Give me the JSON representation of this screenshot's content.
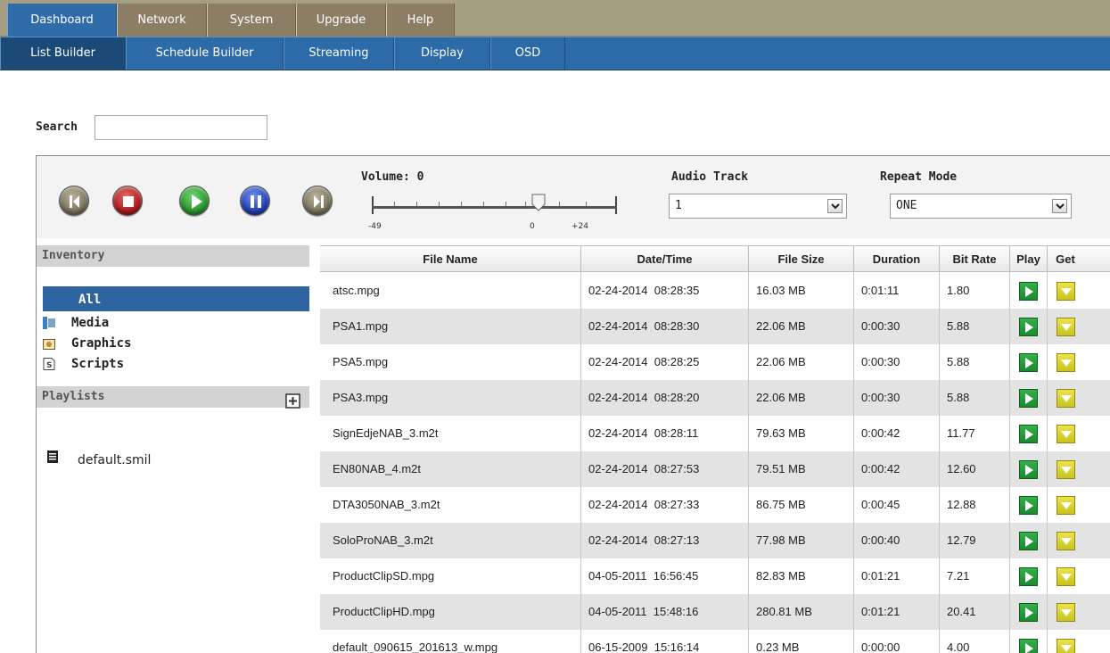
{
  "top_nav": {
    "tabs": [
      {
        "label": "Dashboard",
        "active": true
      },
      {
        "label": "Network"
      },
      {
        "label": "System"
      },
      {
        "label": "Upgrade"
      },
      {
        "label": "Help"
      }
    ]
  },
  "sub_nav": {
    "tabs": [
      {
        "label": "List Builder",
        "active": true
      },
      {
        "label": "Schedule Builder"
      },
      {
        "label": "Streaming"
      },
      {
        "label": "Display"
      },
      {
        "label": "OSD"
      }
    ]
  },
  "search": {
    "label": "Search",
    "value": ""
  },
  "controls": {
    "volume_label": "Volume: 0",
    "volume_value": 0,
    "volume_min_label": "-49",
    "volume_zero_label": "0",
    "volume_max_label": "+24",
    "audio_track_label": "Audio Track",
    "audio_track_value": "1",
    "repeat_mode_label": "Repeat Mode",
    "repeat_mode_value": "ONE"
  },
  "sidebar": {
    "inventory_title": "Inventory",
    "inventory_items": [
      {
        "label": "All",
        "icon": "none",
        "active": true
      },
      {
        "label": "Media",
        "icon": "media-icon"
      },
      {
        "label": "Graphics",
        "icon": "graphics-icon"
      },
      {
        "label": "Scripts",
        "icon": "scripts-icon"
      }
    ],
    "playlists_title": "Playlists",
    "playlists": [
      {
        "label": "default.smil"
      }
    ]
  },
  "table": {
    "headers": [
      "File Name",
      "Date/Time",
      "File Size",
      "Duration",
      "Bit Rate",
      "Play",
      "Get"
    ],
    "rows": [
      {
        "name": "atsc.mpg",
        "datetime": "02-24-2014  08:28:35",
        "size": "16.03 MB",
        "duration": "0:01:11",
        "bitrate": "1.80"
      },
      {
        "name": "PSA1.mpg",
        "datetime": "02-24-2014  08:28:30",
        "size": "22.06 MB",
        "duration": "0:00:30",
        "bitrate": "5.88"
      },
      {
        "name": "PSA5.mpg",
        "datetime": "02-24-2014  08:28:25",
        "size": "22.06 MB",
        "duration": "0:00:30",
        "bitrate": "5.88"
      },
      {
        "name": "PSA3.mpg",
        "datetime": "02-24-2014  08:28:20",
        "size": "22.06 MB",
        "duration": "0:00:30",
        "bitrate": "5.88"
      },
      {
        "name": "SignEdjeNAB_3.m2t",
        "datetime": "02-24-2014  08:28:11",
        "size": "79.63 MB",
        "duration": "0:00:42",
        "bitrate": "11.77"
      },
      {
        "name": "EN80NAB_4.m2t",
        "datetime": "02-24-2014  08:27:53",
        "size": "79.51 MB",
        "duration": "0:00:42",
        "bitrate": "12.60"
      },
      {
        "name": "DTA3050NAB_3.m2t",
        "datetime": "02-24-2014  08:27:33",
        "size": "86.75 MB",
        "duration": "0:00:45",
        "bitrate": "12.88"
      },
      {
        "name": "SoloProNAB_3.m2t",
        "datetime": "02-24-2014  08:27:13",
        "size": "77.98 MB",
        "duration": "0:00:40",
        "bitrate": "12.79"
      },
      {
        "name": "ProductClipSD.mpg",
        "datetime": "04-05-2011  16:56:45",
        "size": "82.83 MB",
        "duration": "0:01:21",
        "bitrate": "7.21"
      },
      {
        "name": "ProductClipHD.mpg",
        "datetime": "04-05-2011  15:48:16",
        "size": "280.81 MB",
        "duration": "0:01:21",
        "bitrate": "20.41"
      },
      {
        "name": "default_090615_201613_w.mpg",
        "datetime": "06-15-2009  15:16:14",
        "size": "0.23 MB",
        "duration": "0:00:00",
        "bitrate": "4.00"
      }
    ]
  },
  "colors": {
    "top_nav_bg": "#a69e83",
    "active_blue": "#2f6ca8",
    "play_green": "#1b8a2f",
    "get_yellow": "#c9c21e"
  }
}
